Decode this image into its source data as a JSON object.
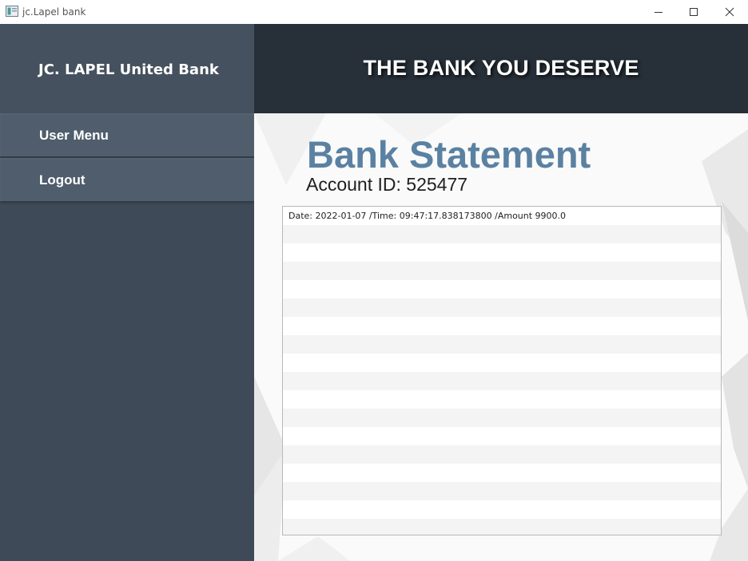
{
  "window": {
    "title": "jc.Lapel bank",
    "controls": {
      "minimize": "minimize-icon",
      "maximize": "maximize-icon",
      "close": "close-icon"
    }
  },
  "sidebar": {
    "brand": "JC. LAPEL United Bank",
    "items": [
      {
        "label": "User Menu"
      },
      {
        "label": "Logout"
      }
    ]
  },
  "header": {
    "tagline": "THE BANK YOU DESERVE"
  },
  "main": {
    "title": "Bank Statement",
    "account_label": "Account ID: ",
    "account_id": "525477",
    "transactions": [
      "Date: 2022-01-07 /Time: 09:47:17.838173800 /Amount 9900.0"
    ]
  },
  "colors": {
    "sidebar": "#3e4a57",
    "nav_item": "#4f5d6c",
    "header": "#272f38",
    "title_accent": "#5b81a2"
  }
}
